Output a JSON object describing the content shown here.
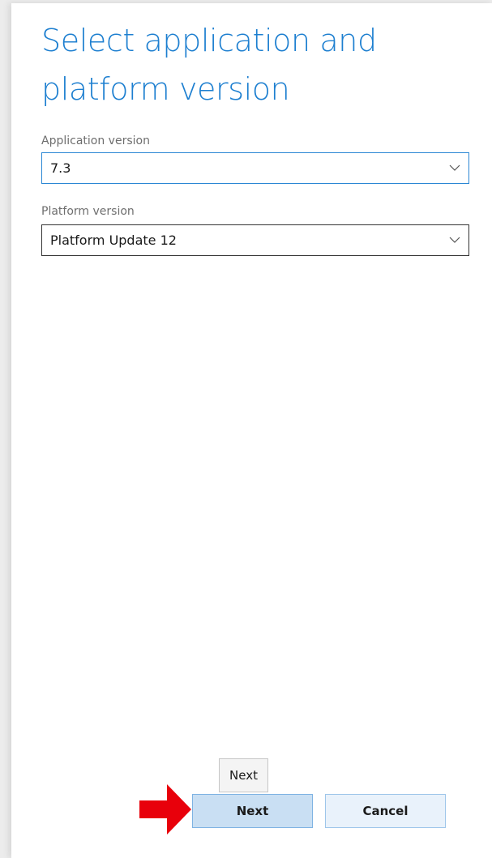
{
  "dialog": {
    "title": "Select application and platform version"
  },
  "fields": {
    "application": {
      "label": "Application version",
      "value": "7.3"
    },
    "platform": {
      "label": "Platform version",
      "value": "Platform Update 12"
    }
  },
  "buttons": {
    "next_label": "Next",
    "cancel_label": "Cancel"
  },
  "tooltip": {
    "text": "Next"
  },
  "icons": {
    "dropdown": "chevron-down-icon",
    "callout": "red-arrow-icon"
  },
  "colors": {
    "title": "#1d7fd0",
    "focus_border": "#2b87d4",
    "primary_button_bg": "#c9dff3",
    "secondary_button_bg": "#e9f2fb",
    "annotation_arrow": "#e8000b"
  }
}
